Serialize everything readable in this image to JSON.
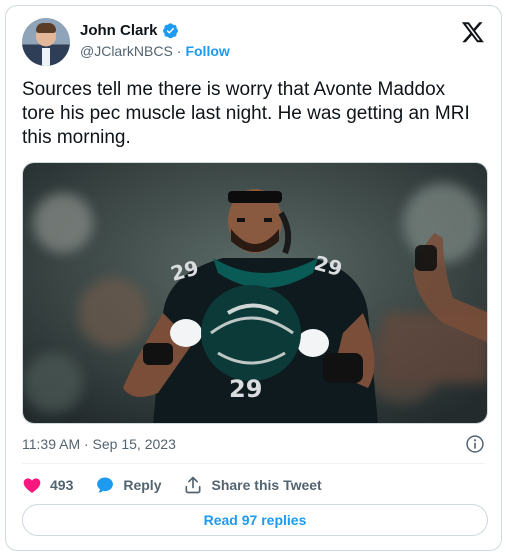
{
  "author": {
    "name": "John Clark",
    "handle": "@JClarkNBCS",
    "separator": "·",
    "follow_label": "Follow",
    "verified": true
  },
  "tweet": {
    "text": "Sources tell me there is worry that Avonte Maddox tore his pec muscle last night. He was getting an MRI this morning.",
    "timestamp": "11:39 AM · Sep 15, 2023"
  },
  "actions": {
    "likes_count": "493",
    "reply_label": "Reply",
    "share_label": "Share this Tweet"
  },
  "read_replies_label": "Read 97 replies",
  "icons": {
    "verified": "verified-badge-icon",
    "logo": "x-logo-icon",
    "info": "info-icon",
    "like": "heart-icon",
    "reply": "reply-bubble-icon",
    "share": "share-icon"
  },
  "colors": {
    "accent": "#1d9bf0",
    "like": "#f91880",
    "text_primary": "#0f1419",
    "text_secondary": "#536471",
    "border": "#cfd9de"
  }
}
